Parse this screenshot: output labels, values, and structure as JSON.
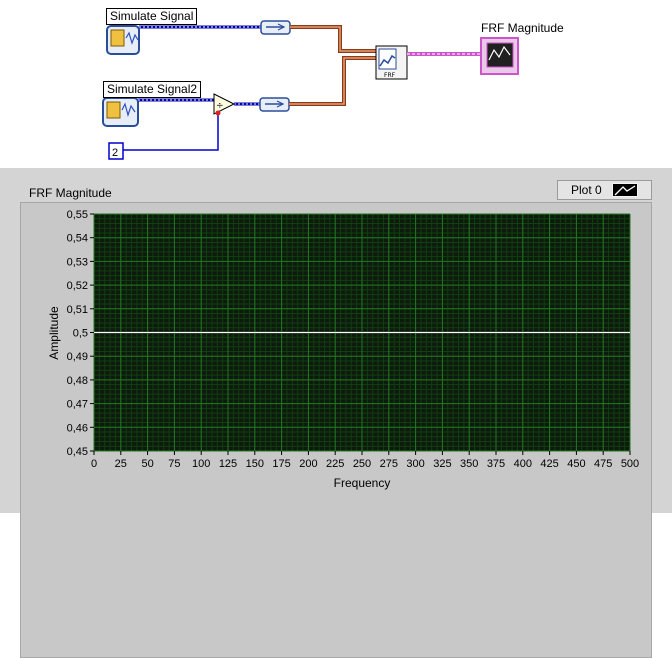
{
  "block_diagram": {
    "simulate_signal_label": "Simulate Signal",
    "simulate_signal2_label": "Simulate Signal2",
    "frf_magnitude_label": "FRF Magnitude",
    "constant_value": "2",
    "frf_icon_text": "FRF",
    "divide_symbol": "÷"
  },
  "front_panel": {
    "graph_title": "FRF Magnitude",
    "legend": {
      "plot_name": "Plot 0"
    }
  },
  "colors": {
    "plot_background": "#0d1a0d",
    "grid_major": "#1f7a1f",
    "grid_minor": "#103f10",
    "plot_line": "#ffffff",
    "dynamic_wire": "#8b3a1a",
    "waveform_wire": "#cc55cc",
    "numeric_wire": "#0000cc"
  },
  "chart_data": {
    "type": "line",
    "title": "FRF Magnitude",
    "xlabel": "Frequency",
    "ylabel": "Amplitude",
    "xlim": [
      0,
      500
    ],
    "ylim": [
      0.45,
      0.55
    ],
    "x_ticks": [
      "0",
      "25",
      "50",
      "75",
      "100",
      "125",
      "150",
      "175",
      "200",
      "225",
      "250",
      "275",
      "300",
      "325",
      "350",
      "375",
      "400",
      "425",
      "450",
      "475",
      "500"
    ],
    "y_ticks": [
      "0,55",
      "0,54",
      "0,53",
      "0,52",
      "0,51",
      "0,5",
      "0,49",
      "0,48",
      "0,47",
      "0,46",
      "0,45"
    ],
    "series": [
      {
        "name": "Plot 0",
        "x": [
          0,
          500
        ],
        "y": [
          0.5,
          0.5
        ]
      }
    ],
    "grid": true,
    "legend_position": "top-right"
  }
}
